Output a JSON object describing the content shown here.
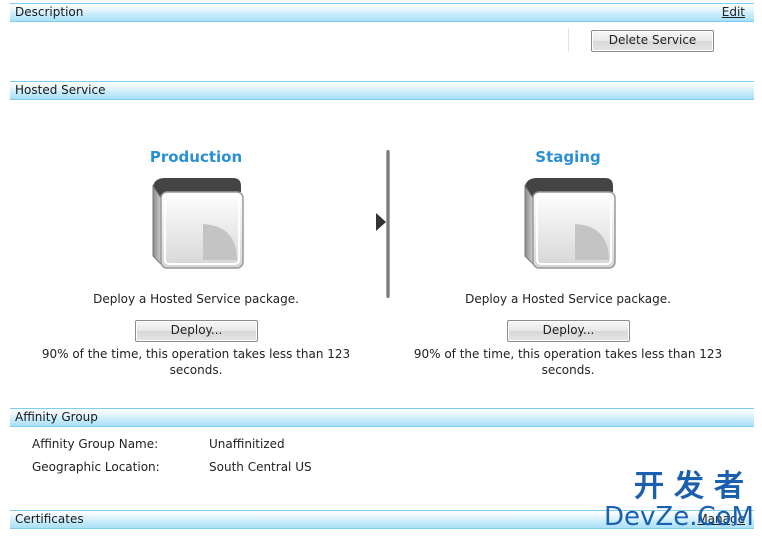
{
  "description": {
    "title": "Description",
    "edit_label": "Edit",
    "delete_button": "Delete Service"
  },
  "hosted_service": {
    "title": "Hosted Service",
    "production": {
      "title": "Production",
      "deploy_text": "Deploy a Hosted Service package.",
      "deploy_button": "Deploy...",
      "note_line1": "90% of the time, this operation takes less than 123",
      "note_line2": "seconds."
    },
    "staging": {
      "title": "Staging",
      "deploy_text": "Deploy a Hosted Service package.",
      "deploy_button": "Deploy...",
      "note_line1": "90% of the time, this operation takes less than 123",
      "note_line2": "seconds."
    }
  },
  "affinity_group": {
    "title": "Affinity Group",
    "rows": [
      {
        "label": "Affinity Group Name:",
        "value": "Unaffinitized"
      },
      {
        "label": "Geographic Location:",
        "value": "South Central US"
      }
    ]
  },
  "certificates": {
    "title": "Certificates",
    "manage_label": "Manage"
  },
  "watermark": {
    "line1": "开发者",
    "line2": "DevZe.CoM"
  },
  "colors": {
    "header_border": "#7fcdee",
    "slot_title": "#2b8fd6",
    "watermark": "#1a5fb0"
  }
}
